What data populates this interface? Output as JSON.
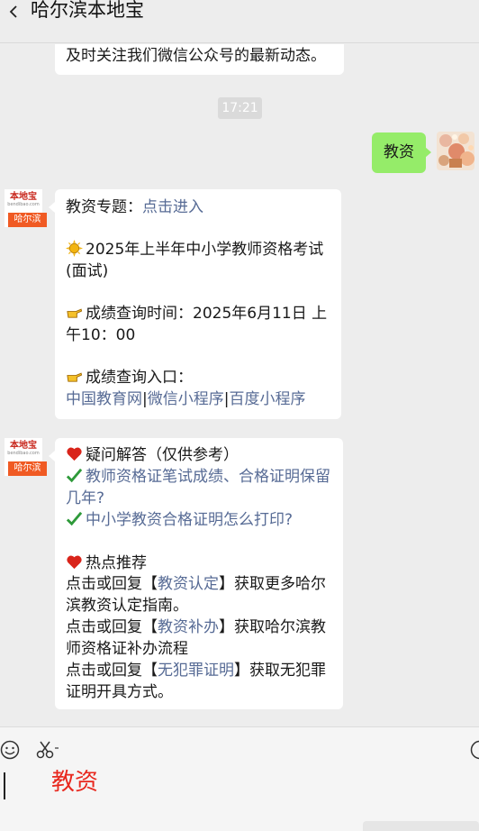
{
  "header": {
    "title": "哈尔滨本地宝"
  },
  "messages": {
    "prev_text": "及时关注我们微信公众号的最新动态。",
    "timestamp": "17:21",
    "user_msg": "教资",
    "reply1": {
      "topic_label": "教资专题：",
      "topic_link": "点击进入",
      "exam_title": "2025年上半年中小学教师资格考试(面试)",
      "score_time": "成绩查询时间：2025年6月11日 上午10：00",
      "entry_label": "成绩查询入口：",
      "entry_link1": "中国教育网",
      "sep": "|",
      "entry_link2": "微信小程序",
      "entry_link3": "百度小程序"
    },
    "reply2": {
      "faq_title": "疑问解答（仅供参考）",
      "faq1": "教师资格证笔试成绩、合格证明保留几年?",
      "faq2": "中小学教资合格证明怎么打印?",
      "hot_title": "热点推荐",
      "line1_pre": "点击或回复【",
      "line1_link": "教资认定",
      "line1_post": "】获取更多哈尔滨教资认定指南。",
      "line2_pre": "点击或回复【",
      "line2_link": "教资补办",
      "line2_post": "】获取哈尔滨教师资格证补办流程",
      "line3_pre": "点击或回复【",
      "line3_link": "无犯罪证明",
      "line3_post": "】获取无犯罪证明开具方式。"
    }
  },
  "logo": {
    "top": "本地宝",
    "url": "bendibao.com",
    "bottom": "哈尔滨"
  },
  "input": {
    "value": "教资"
  },
  "icons": [
    "back-icon",
    "emoji-icon",
    "scissors-icon",
    "sun-emoji-icon",
    "pointing-hand-icon",
    "heart-icon",
    "checkmark-icon"
  ],
  "colors": {
    "link": "#576b95",
    "user_bubble": "#95ec69",
    "input_text": "#e8281e",
    "logo_orange": "#f05a23"
  }
}
